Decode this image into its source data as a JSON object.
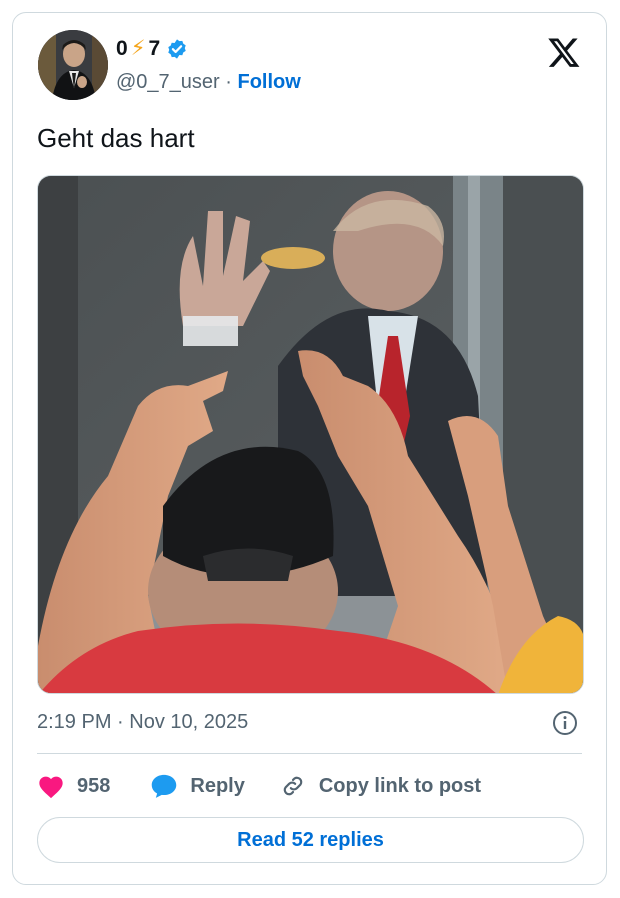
{
  "author": {
    "display_name_part1": "0",
    "display_name_bolt": "⚡",
    "display_name_part2": "7",
    "handle": "@0_7_user",
    "separator": "·",
    "follow_label": "Follow"
  },
  "icons": {
    "avatar": "avatar-photo",
    "verified": "verified-badge-icon",
    "platform": "x-logo-icon",
    "info": "info-icon",
    "like": "heart-icon",
    "reply": "reply-bubble-icon",
    "copy_link": "link-icon"
  },
  "tweet": {
    "text": "Geht das hart",
    "timestamp": "2:19 PM · Nov 10, 2025"
  },
  "actions": {
    "like_count": "958",
    "reply_label": "Reply",
    "copy_link_label": "Copy link to post"
  },
  "read_replies_label": "Read 52 replies",
  "colors": {
    "accent": "#006fd6",
    "like": "#f91880",
    "reply": "#1d9bf0",
    "text_secondary": "#536471",
    "border": "#cfd9de"
  }
}
